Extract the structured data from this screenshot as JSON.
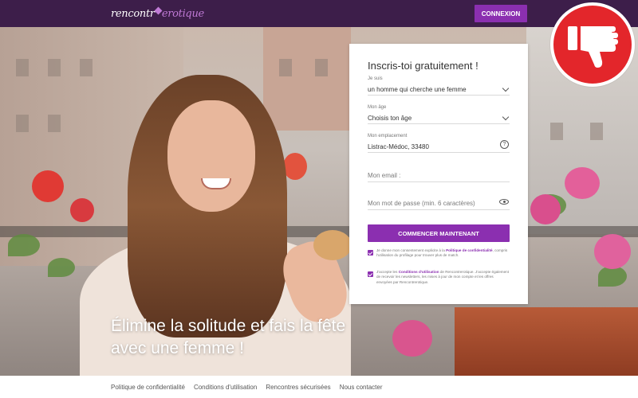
{
  "header": {
    "logo_part1": "rencontr",
    "logo_part2": "erotique",
    "login_label": "CONNEXION"
  },
  "hero": {
    "headline": "Élimine la solitude et fais la fête avec une femme !"
  },
  "form": {
    "title": "Inscris-toi gratuitement !",
    "iam": {
      "label": "Je suis",
      "value": "un homme qui cherche une femme"
    },
    "age": {
      "label": "Mon âge",
      "value": "Choisis ton âge"
    },
    "location": {
      "label": "Mon emplacement",
      "value": "Listrac-Médoc, 33480"
    },
    "email": {
      "placeholder": "Mon email :"
    },
    "password": {
      "placeholder": "Mon mot de passe (min. 6 caractères)"
    },
    "submit_label": "COMMENCER MAINTENANT",
    "consent1": {
      "before": "Je donne mon consentement explicite à la",
      "link": "Politique de confidentialité",
      "after": ", compris l'utilisation du profilage pour trouver plus de match."
    },
    "consent2": {
      "before": "J'accepte les",
      "link": "Conditions d'utilisation",
      "after": "de Rencontrerotique. J'accepte également de recevoir les newsletters, les mises à jour de mon compte et les offres envoyées par Rencontrerotique."
    }
  },
  "badge": {
    "icon": "thumbs-down-icon",
    "color": "#e3262b"
  },
  "footer": {
    "links": [
      "Politique de confidentialité",
      "Conditions d'utilisation",
      "Rencontres sécurisées",
      "Nous contacter"
    ]
  },
  "colors": {
    "header_bg": "#3d1e4a",
    "accent_purple": "#8b2fb0",
    "badge_red": "#e3262b"
  }
}
